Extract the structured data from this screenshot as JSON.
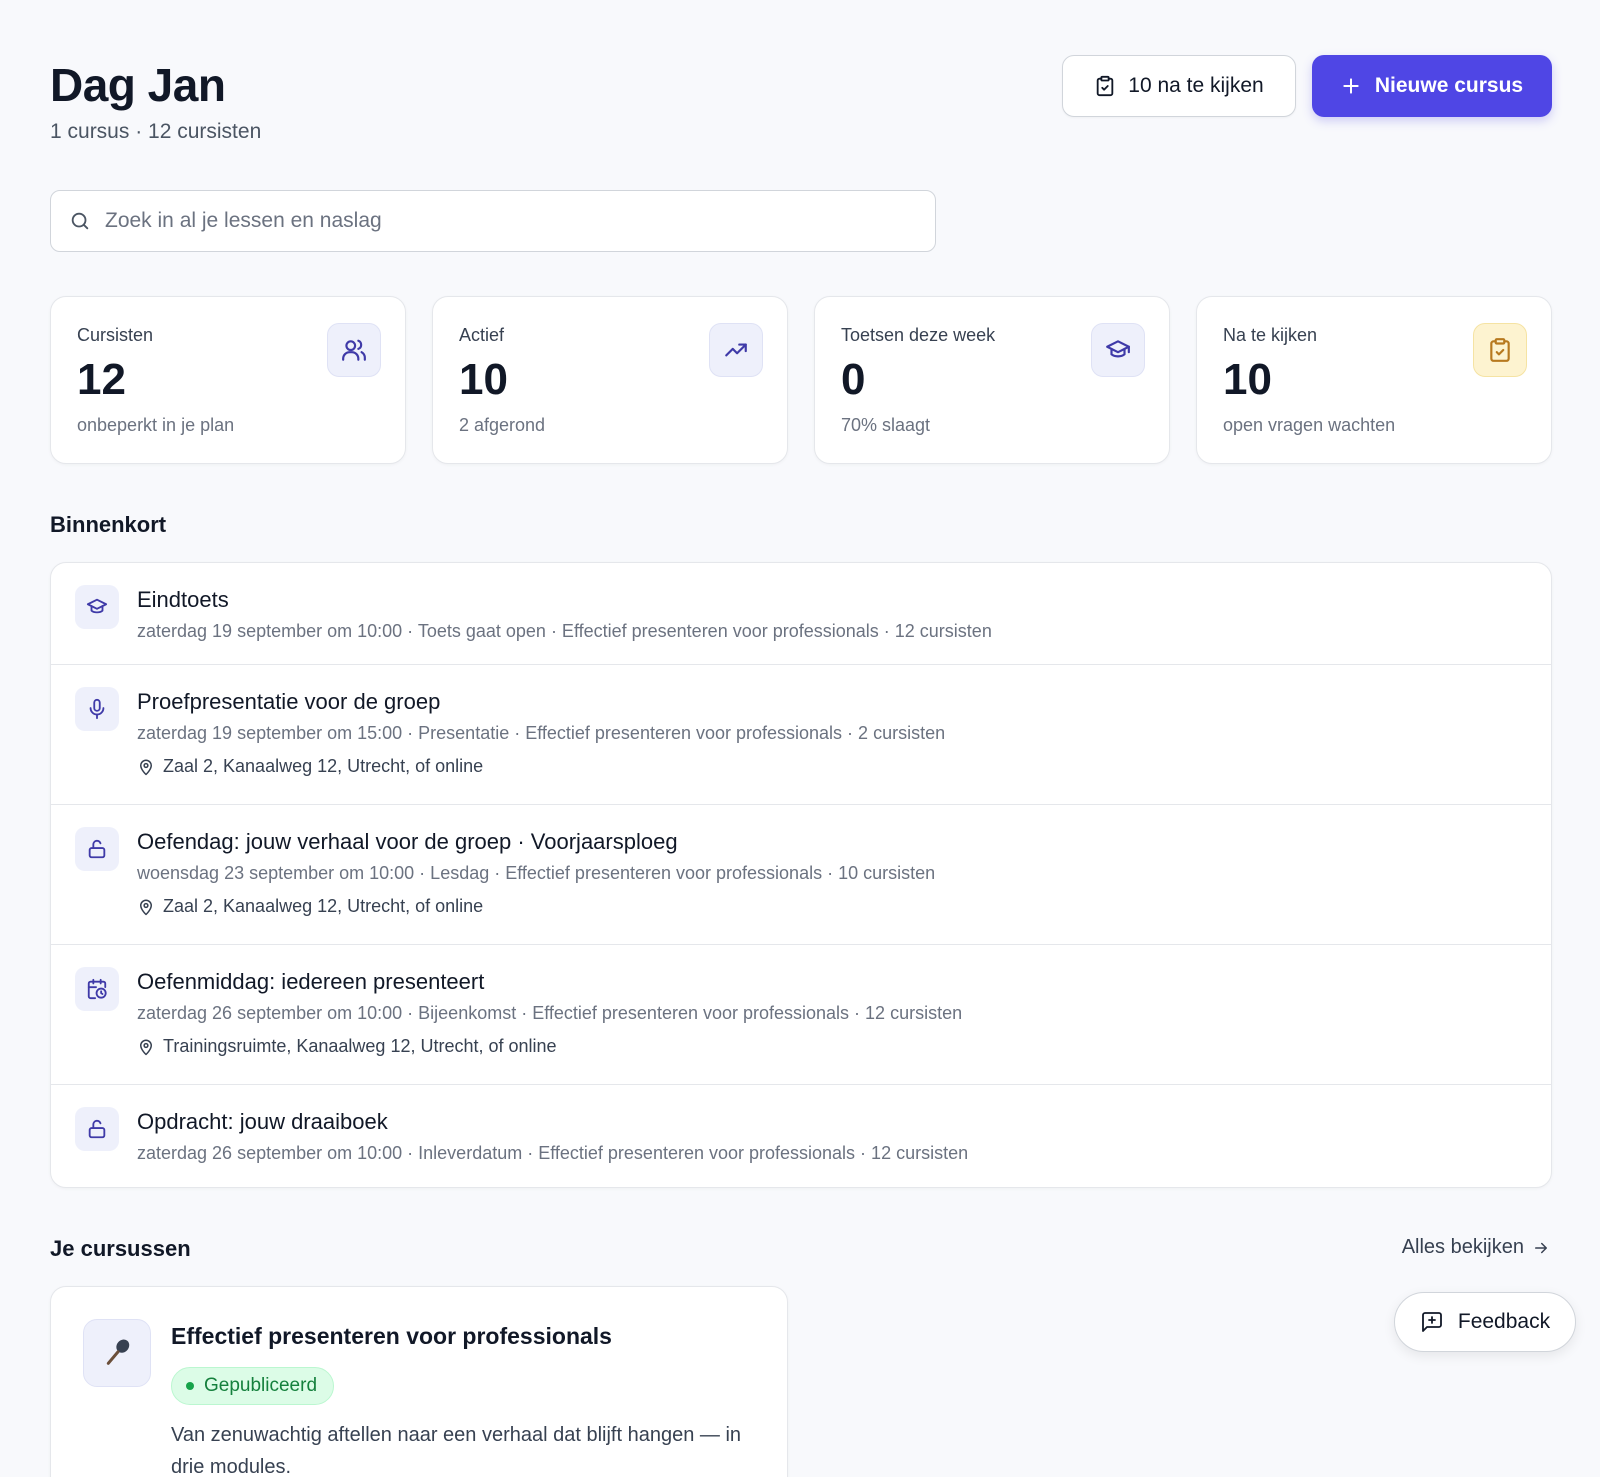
{
  "header": {
    "greeting": "Dag Jan",
    "subline": "1 cursus · 12 cursisten",
    "review_button": "10 na te kijken",
    "new_course_button": "Nieuwe cursus"
  },
  "search": {
    "placeholder": "Zoek in al je lessen en naslag"
  },
  "stats": [
    {
      "label": "Cursisten",
      "value": "12",
      "sub": "onbeperkt in je plan",
      "icon": "users-icon"
    },
    {
      "label": "Actief",
      "value": "10",
      "sub": "2 afgerond",
      "icon": "trending-up-icon"
    },
    {
      "label": "Toetsen deze week",
      "value": "0",
      "sub": "70% slaagt",
      "icon": "graduation-cap-icon"
    },
    {
      "label": "Na te kijken",
      "value": "10",
      "sub": "open vragen wachten",
      "icon": "clipboard-check-icon"
    }
  ],
  "upcoming": {
    "title": "Binnenkort",
    "items": [
      {
        "title": "Eindtoets",
        "meta": "zaterdag 19 september om 10:00 · Toets gaat open · Effectief presenteren voor professionals · 12 cursisten",
        "location": "",
        "icon": "graduation-cap-icon"
      },
      {
        "title": "Proefpresentatie voor de groep",
        "meta": "zaterdag 19 september om 15:00 · Presentatie · Effectief presenteren voor professionals · 2 cursisten",
        "location": "Zaal 2, Kanaalweg 12, Utrecht, of online",
        "icon": "microphone-icon"
      },
      {
        "title": "Oefendag: jouw verhaal voor de groep · Voorjaarsploeg",
        "meta": "woensdag 23 september om 10:00 · Lesdag · Effectief presenteren voor professionals · 10 cursisten",
        "location": "Zaal 2, Kanaalweg 12, Utrecht, of online",
        "icon": "unlock-icon"
      },
      {
        "title": "Oefenmiddag: iedereen presenteert",
        "meta": "zaterdag 26 september om 10:00 · Bijeenkomst · Effectief presenteren voor professionals · 12 cursisten",
        "location": "Trainingsruimte, Kanaalweg 12, Utrecht, of online",
        "icon": "calendar-clock-icon"
      },
      {
        "title": "Opdracht: jouw draaiboek",
        "meta": "zaterdag 26 september om 10:00 · Inleverdatum · Effectief presenteren voor professionals · 12 cursisten",
        "location": "",
        "icon": "unlock-icon"
      }
    ]
  },
  "courses": {
    "title": "Je cursussen",
    "view_all": "Alles bekijken",
    "items": [
      {
        "title": "Effectief presenteren voor professionals",
        "status": "Gepubliceerd",
        "description": "Van zenuwachtig aftellen naar een verhaal dat blijft hangen — in drie modules.",
        "icon": "microphone-icon"
      }
    ]
  },
  "feedback_button": "Feedback",
  "colors": {
    "accent": "#4f46e5",
    "status_published": "#15803d",
    "warning_bg": "#fdf3d0"
  }
}
